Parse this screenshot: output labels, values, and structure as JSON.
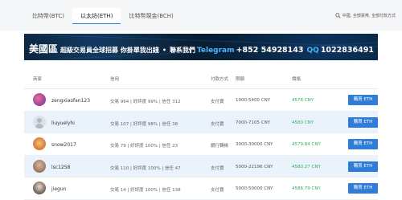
{
  "tabs": [
    {
      "label": "比特幣(BTC)",
      "active": false
    },
    {
      "label": "以太坊(ETH)",
      "active": true
    },
    {
      "label": "比特幣現金(BCH)",
      "active": false
    }
  ],
  "filter": {
    "label": "中國, 全部貨幣, 全部付款方式",
    "icon": "search-icon"
  },
  "banner": {
    "region": "美國區",
    "headline": "超級交易員全球招募 你掛單我出錢",
    "separator": "•",
    "contact_label": "聯系我們",
    "telegram_label": "Telegram",
    "phone": "+852 54928143",
    "qq_label": "QQ",
    "qq_number": "1022836491"
  },
  "table": {
    "headers": {
      "user": "商家",
      "credit": "信用",
      "payment": "付款方式",
      "limit": "限額",
      "price": "價格"
    },
    "rows": [
      {
        "name": "zengxiaofan123",
        "stats": "交易 964 | 好評度 99% | 信任 312",
        "payment": "支付寶",
        "limit": "1000-5400 CNY",
        "price": "4578 CNY",
        "button": "購買 ETH",
        "highlight": false
      },
      {
        "name": "liuyuelyhi",
        "stats": "交易 107 | 好評度 98% | 信任 38",
        "payment": "支付寶",
        "limit": "7000-7105 CNY",
        "price": "4580 CNY",
        "button": "購買 ETH",
        "highlight": true
      },
      {
        "name": "snow2017",
        "stats": "交易 79 | 好評度 100% | 信任 23",
        "payment": "銀行轉帳",
        "limit": "3000-30000 CNY",
        "price": "4579.84 CNY",
        "button": "購買 ETH",
        "highlight": false
      },
      {
        "name": "lsc1258",
        "stats": "交易 110 | 好評度 100% | 信任 47",
        "payment": "支付寶",
        "limit": "5000-22196 CNY",
        "price": "4580.27 CNY",
        "button": "購買 ETH",
        "highlight": true
      },
      {
        "name": "jiegun",
        "stats": "交易 14 | 好評度 100% | 信任 138",
        "payment": "支付寶",
        "limit": "5000-50000 CNY",
        "price": "4586.79 CNY",
        "button": "購買 ETH",
        "highlight": false
      }
    ]
  },
  "colors": {
    "accent": "#2f7dd9",
    "price": "#2fae60",
    "banner_bg": "#071a2b",
    "highlight_row": "#eaf2fb"
  }
}
